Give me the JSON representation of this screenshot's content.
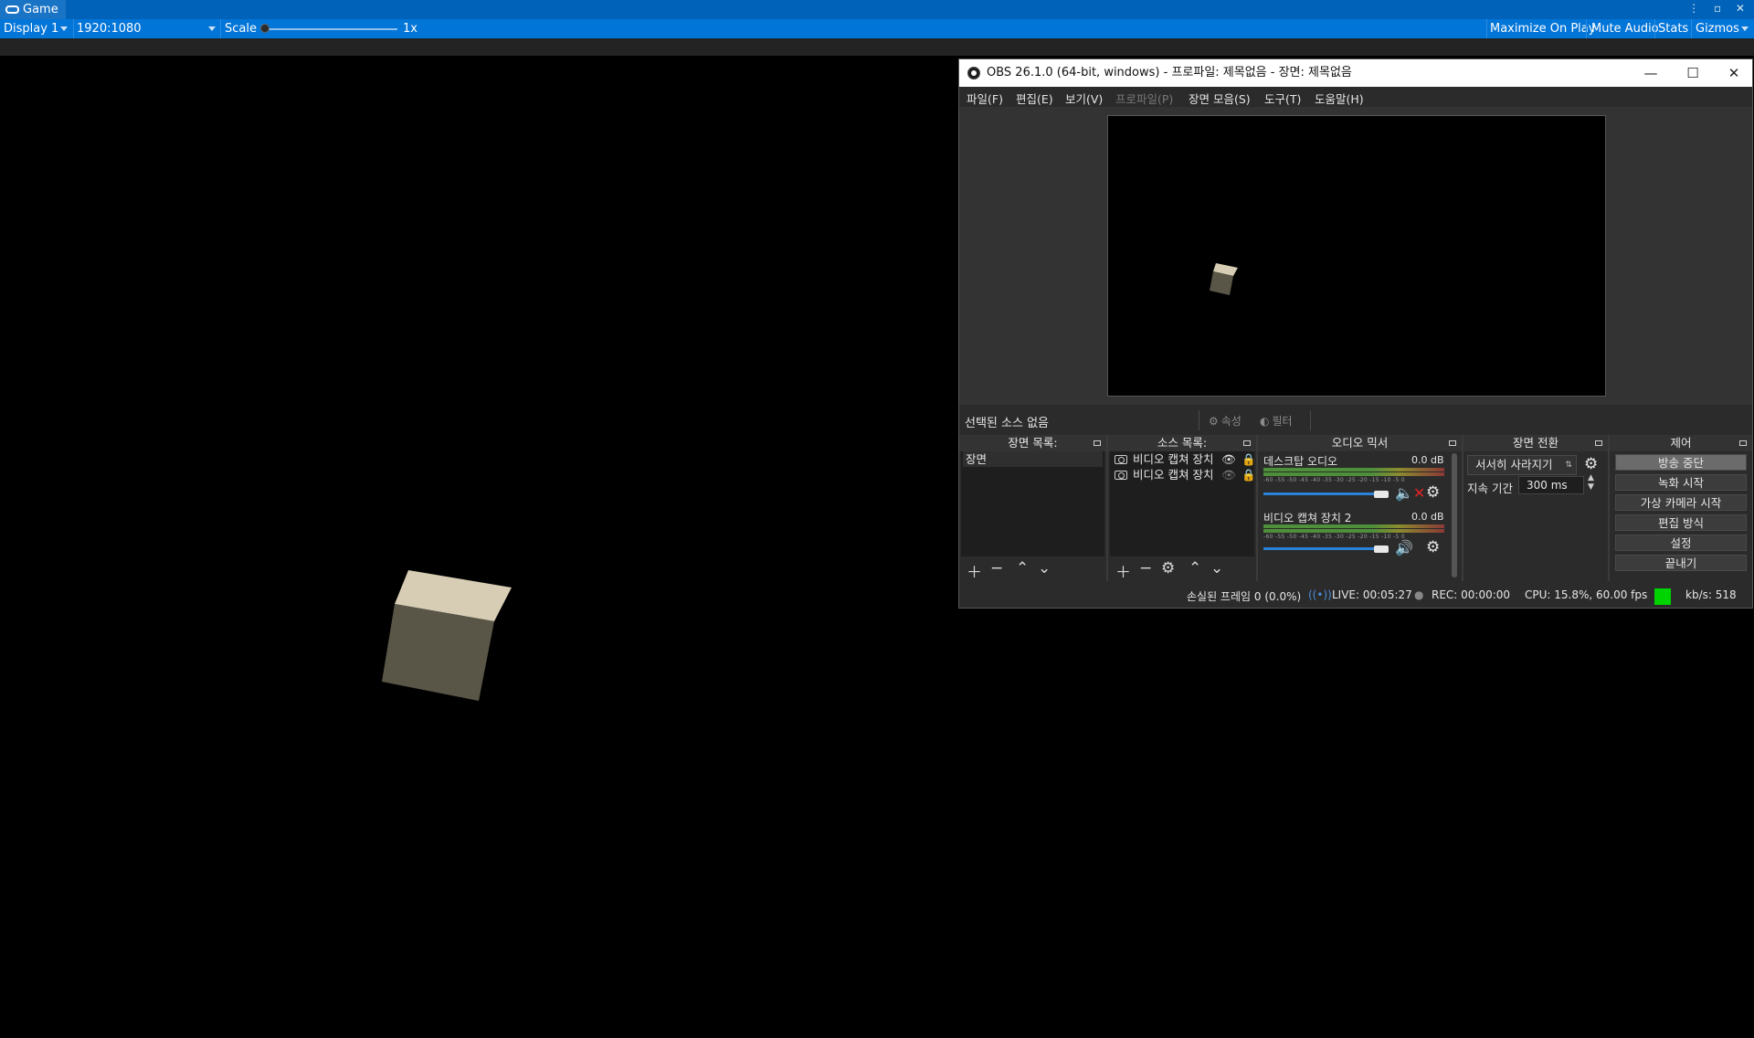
{
  "unity": {
    "tab_label": "Game",
    "window_controls": "⋮ ▫ ✕",
    "toolbar": {
      "display": "Display 1",
      "resolution": "1920:1080",
      "scale_label": "Scale",
      "scale_value": "1x",
      "maximize_on_play": "Maximize On Play",
      "mute_audio": "Mute Audio",
      "stats": "Stats",
      "gizmos": "Gizmos"
    }
  },
  "obs": {
    "title": "OBS 26.1.0 (64-bit, windows) - 프로파일: 제목없음 - 장면: 제목없음",
    "window_buttons": {
      "minimize": "—",
      "maximize": "☐",
      "close": "✕"
    },
    "menu": [
      "파일(F)",
      "편집(E)",
      "보기(V)",
      "프로파일(P)",
      "장면 모음(S)",
      "도구(T)",
      "도움말(H)"
    ],
    "source_bar": {
      "no_source": "선택된 소스 없음",
      "properties": "속성",
      "filters": "필터"
    },
    "scenes": {
      "title": "장면 목록:",
      "items": [
        "장면"
      ]
    },
    "sources": {
      "title": "소스 목록:",
      "items": [
        "비디오 캡쳐 장치",
        "비디오 캡쳐 장치"
      ]
    },
    "mixer": {
      "title": "오디오 믹서",
      "channels": [
        {
          "name": "데스크탑 오디오",
          "db": "0.0 dB",
          "muted": true,
          "volume": 0.95
        },
        {
          "name": "비디오 캡쳐 장치 2",
          "db": "0.0 dB",
          "muted": false,
          "volume": 0.95
        }
      ],
      "scale_ticks": "-60 -55 -50 -45 -40 -35 -30 -25 -20 -15 -10 -5 0"
    },
    "transitions": {
      "title": "장면 전환",
      "selected": "서서히 사라지기",
      "duration_label": "지속 기간",
      "duration_value": "300 ms"
    },
    "controls": {
      "title": "제어",
      "buttons": [
        "방송 중단",
        "녹화 시작",
        "가상 카메라 시작",
        "편집 방식",
        "설정",
        "끝내기"
      ]
    },
    "status": {
      "dropped": "손실된 프레임 0 (0.0%)",
      "live": "LIVE: 00:05:27",
      "rec": "REC: 00:00:00",
      "cpu": "CPU: 15.8%, 60.00 fps",
      "kbps": "kb/s: 518"
    },
    "colors": {
      "live_indicator": "#00d400",
      "mute_red": "#e02424",
      "fader_blue": "#2a82da"
    }
  }
}
